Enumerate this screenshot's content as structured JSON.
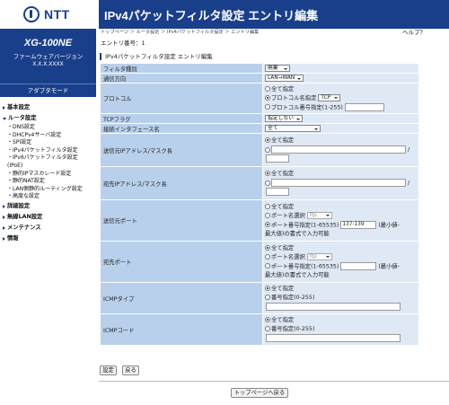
{
  "brand": {
    "logo_text": "NTT"
  },
  "device": {
    "model": "XG-100NE",
    "firmware_label": "ファームウェアバージョン",
    "firmware_version": "X.X.X.XXXX",
    "mode": "アダプタモード"
  },
  "nav": {
    "basic": "基本設定",
    "router": "ルータ設定",
    "router_items": [
      "DNS設定",
      "DHCPv4サーバ設定",
      "SPI設定",
      "IPv4パケットフィルタ設定",
      "IPv6パケットフィルタ設定",
      "(IPoE)",
      "静的IPマスカレード設定",
      "静的NAT設定",
      "LAN側静的ルーティング設定",
      "高度な設定"
    ],
    "details": "詳細設定",
    "wireless": "無線LAN設定",
    "maintenance": "メンテナンス",
    "info": "情報"
  },
  "header": {
    "title": "IPv4パケットフィルタ設定 エントリ編集",
    "breadcrumb": "トップページ ＞ ルータ設定 ＞ IPv4パケットフィルタ設定 ＞ エントリ編集",
    "help": "ヘルプ？",
    "entry_no": "エントリ番号：1",
    "section": "IPv4パケットフィルタ設定 エントリ編集"
  },
  "form": {
    "filter_type": {
      "label": "フィルタ種別",
      "value": "廃棄"
    },
    "direction": {
      "label": "通信方向",
      "value": "LAN→WAN"
    },
    "protocol": {
      "label": "プロトコル",
      "opt_all": "全て指定",
      "opt_name": "プロトコル名指定",
      "name_value": "TCP",
      "opt_num": "プロトコル番号指定(1-255)"
    },
    "tcp_flag": {
      "label": "TCPフラグ",
      "value": "指定しない"
    },
    "interface": {
      "label": "接続インタフェース名",
      "value": "全て"
    },
    "src_ip": {
      "label": "送信元IPアドレス/マスク長",
      "opt_all": "全て指定",
      "slash": "/"
    },
    "dst_ip": {
      "label": "宛先IPアドレス/マスク長",
      "opt_all": "全て指定",
      "slash": "/"
    },
    "src_port": {
      "label": "送信元ポート",
      "opt_all": "全て指定",
      "opt_name": "ポート名選択",
      "name_value": "ftp",
      "opt_num": "ポート番号指定(1-65535)",
      "num_value": "137-139",
      "note1": "(最小値-",
      "note2": "最大値)の書式で入力可能"
    },
    "dst_port": {
      "label": "宛先ポート",
      "opt_all": "全て指定",
      "opt_name": "ポート名選択",
      "name_value": "ftp",
      "opt_num": "ポート番号指定(1-65535)",
      "note1": "(最小値-",
      "note2": "最大値)の書式で入力可能"
    },
    "icmp_type": {
      "label": "ICMPタイプ",
      "opt_all": "全て指定",
      "opt_num": "番号指定(0-255)"
    },
    "icmp_code": {
      "label": "ICMPコード",
      "opt_all": "全て指定",
      "opt_num": "番号指定(0-255)"
    }
  },
  "buttons": {
    "set": "設定",
    "back": "戻る",
    "top": "トップページへ戻る"
  }
}
